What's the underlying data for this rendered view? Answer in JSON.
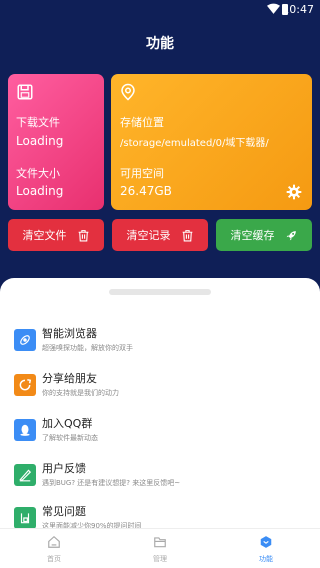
{
  "status": {
    "time": "10:47"
  },
  "header": {
    "title": "功能"
  },
  "cards": {
    "download": {
      "files_label": "下载文件",
      "files_value": "Loading",
      "size_label": "文件大小",
      "size_value": "Loading"
    },
    "storage": {
      "location_label": "存储位置",
      "path": "/storage/emulated/0/域下载器/",
      "free_label": "可用空间",
      "free_value": "26.47GB"
    }
  },
  "actions": {
    "clear_files": "清空文件",
    "clear_records": "清空记录",
    "clear_cache": "清空缓存"
  },
  "menu": [
    {
      "name": "智能浏览器",
      "desc": "超强嗅探功能，解放你的双手",
      "icon": "browser-icon",
      "color": "#3b8df5"
    },
    {
      "name": "分享给朋友",
      "desc": "你的支持就是我们的动力",
      "icon": "share-icon",
      "color": "#f28a17"
    },
    {
      "name": "加入QQ群",
      "desc": "了解软件最新动态",
      "icon": "qq-icon",
      "color": "#3b8df5"
    },
    {
      "name": "用户反馈",
      "desc": "遇到BUG?  还是有建议想提?  来这里反馈吧~",
      "icon": "feedback-icon",
      "color": "#2fae6a"
    },
    {
      "name": "常见问题",
      "desc": "这里面能减少你90%的提问时间",
      "icon": "question-icon",
      "color": "#2fae6a"
    }
  ],
  "tabs": [
    {
      "label": "首页",
      "icon": "home-icon"
    },
    {
      "label": "管理",
      "icon": "folder-icon"
    },
    {
      "label": "功能",
      "icon": "function-icon",
      "active": true
    }
  ],
  "colors": {
    "header_bg": "#0f1f57",
    "accent": "#3b8df5",
    "pink": "#ff5ea0",
    "orange": "#ffb52a",
    "red": "#e3303f",
    "green": "#3aa84a"
  }
}
